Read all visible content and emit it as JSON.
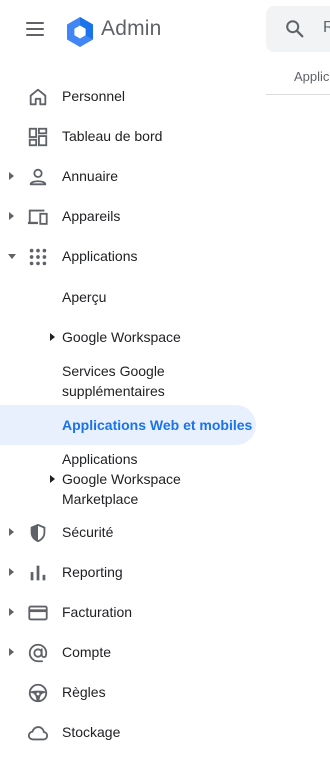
{
  "header": {
    "app_name": "Admin",
    "search_placeholder": "R",
    "tab_label": "Applic"
  },
  "nav": {
    "items": [
      {
        "label": "Personnel",
        "icon": "home-icon"
      },
      {
        "label": "Tableau de bord",
        "icon": "dashboard-icon"
      },
      {
        "label": "Annuaire",
        "icon": "person-icon"
      },
      {
        "label": "Appareils",
        "icon": "devices-icon"
      },
      {
        "label": "Applications",
        "icon": "apps-grid-icon"
      },
      {
        "label": "Sécurité",
        "icon": "shield-icon"
      },
      {
        "label": "Reporting",
        "icon": "bar-chart-icon"
      },
      {
        "label": "Facturation",
        "icon": "credit-card-icon"
      },
      {
        "label": "Compte",
        "icon": "at-sign-icon"
      },
      {
        "label": "Règles",
        "icon": "steering-wheel-icon"
      },
      {
        "label": "Stockage",
        "icon": "cloud-icon"
      }
    ],
    "applications_sub": [
      {
        "label": "Aperçu"
      },
      {
        "label": "Google Workspace"
      },
      {
        "label_line1": "Services Google",
        "label_line2": "supplémentaires"
      },
      {
        "label": "Applications Web et mobiles",
        "active": true
      },
      {
        "label_line1": "Applications",
        "label_line2": "Google Workspace",
        "label_line3": "Marketplace"
      }
    ]
  },
  "colors": {
    "accent": "#1a73e8",
    "active_bg": "#e8f0fe",
    "icon": "#5f6368",
    "text": "#202124"
  }
}
